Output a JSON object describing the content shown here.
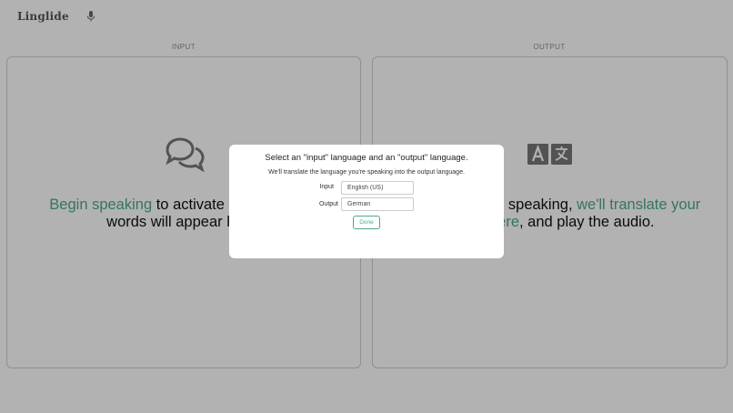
{
  "app": {
    "name": "Linglide"
  },
  "panels": {
    "input": {
      "label": "INPUT",
      "text_highlight": "Begin speaking",
      "text_line1_rest": " to activate our app. Your",
      "text_line2": "words will appear here."
    },
    "output": {
      "label": "OUTPUT",
      "text_line1_pre": "Once you begin speaking, ",
      "text_line1_highlight": "we'll translate your",
      "text_line2_highlight": "words here",
      "text_line2_rest": ", and play the audio."
    }
  },
  "modal": {
    "title": "Select an \"input\" language and an \"output\" language.",
    "subtitle": "We'll translate the language you're speaking into the output language.",
    "input_label": "Input",
    "input_value": "English (US)",
    "output_label": "Output",
    "output_value": "German",
    "done_label": "Done"
  },
  "colors": {
    "accent": "#4aa98a",
    "overlay": "rgba(0,0,0,0.30)",
    "icon": "#777777"
  },
  "icons": {
    "mic": "microphone-icon",
    "input_panel": "chat-bubbles-icon",
    "output_panel": "translate-icon"
  }
}
